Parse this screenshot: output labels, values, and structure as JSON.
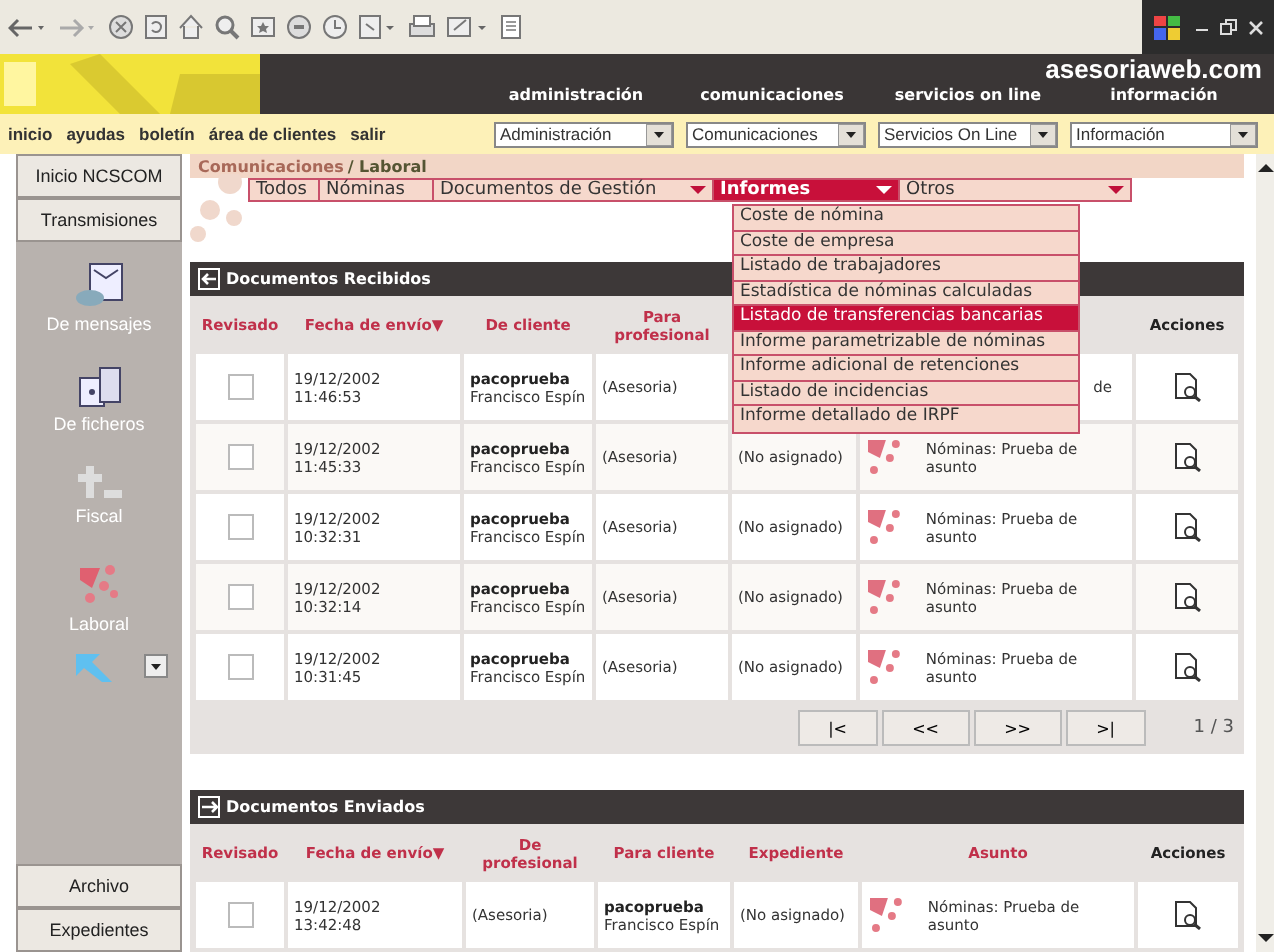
{
  "header": {
    "site": "asesoriaweb.com",
    "nav": [
      "administración",
      "comunicaciones",
      "servicios on line",
      "información"
    ]
  },
  "links": [
    "inicio",
    "ayudas",
    "boletín",
    "área de clientes",
    "salir"
  ],
  "selects": [
    "Administración",
    "Comunicaciones",
    "Servicios On Line",
    "Información"
  ],
  "sidebar": {
    "top_buttons": [
      "Inicio NCSCOM",
      "Transmisiones"
    ],
    "items": [
      {
        "label": "De mensajes",
        "kind": "messages"
      },
      {
        "label": "De ficheros",
        "kind": "files"
      },
      {
        "label": "Fiscal",
        "kind": "fiscal"
      },
      {
        "label": "Laboral",
        "kind": "laboral"
      }
    ],
    "bottom_buttons": [
      "Archivo",
      "Expedientes"
    ]
  },
  "breadcrumb": {
    "parent": "Comunicaciones",
    "current": "/ Laboral"
  },
  "tabs": [
    {
      "label": "Todos",
      "selected": false,
      "dropdown": false
    },
    {
      "label": "Nóminas",
      "selected": false,
      "dropdown": false
    },
    {
      "label": "Documentos de Gestión",
      "selected": false,
      "dropdown": true
    },
    {
      "label": "Informes",
      "selected": true,
      "dropdown": true
    },
    {
      "label": "Otros",
      "selected": false,
      "dropdown": true
    }
  ],
  "menu": [
    {
      "label": "Coste de nómina",
      "selected": false
    },
    {
      "label": "Coste de empresa",
      "selected": false
    },
    {
      "label": "Listado de trabajadores",
      "selected": false
    },
    {
      "label": "Estadística de nóminas calculadas",
      "selected": false
    },
    {
      "label": "Listado de transferencias bancarias",
      "selected": true
    },
    {
      "label": "Informe parametrizable de nóminas",
      "selected": false
    },
    {
      "label": "Informe adicional de retenciones",
      "selected": false
    },
    {
      "label": "Listado de incidencias",
      "selected": false
    },
    {
      "label": "Informe detallado de IRPF",
      "selected": false
    }
  ],
  "received": {
    "title": "Documentos Recibidos",
    "columns": [
      {
        "label": "Revisado"
      },
      {
        "label": "Fecha de envío",
        "sort_mark": "▼"
      },
      {
        "label": "De cliente"
      },
      {
        "label": "Para profesional"
      },
      {
        "label": "Acciones"
      }
    ],
    "rows": [
      {
        "checked": false,
        "date": "19/12/2002",
        "time": "11:46:53",
        "user": "pacoprueba",
        "name": "Francisco Espín",
        "profesional": "(Asesoria)",
        "asunto": "de",
        "asunto_icon": false
      },
      {
        "checked": false,
        "date": "19/12/2002",
        "time": "11:45:33",
        "user": "pacoprueba",
        "name": "Francisco Espín",
        "profesional": "(Asesoria)",
        "expediente": "(No asignado)",
        "asunto": "Nóminas: Prueba de asunto",
        "asunto_icon": true
      },
      {
        "checked": false,
        "date": "19/12/2002",
        "time": "10:32:31",
        "user": "pacoprueba",
        "name": "Francisco Espín",
        "profesional": "(Asesoria)",
        "expediente": "(No asignado)",
        "asunto": "Nóminas: Prueba de asunto",
        "asunto_icon": true
      },
      {
        "checked": false,
        "date": "19/12/2002",
        "time": "10:32:14",
        "user": "pacoprueba",
        "name": "Francisco Espín",
        "profesional": "(Asesoria)",
        "expediente": "(No asignado)",
        "asunto": "Nóminas: Prueba de asunto",
        "asunto_icon": true
      },
      {
        "checked": false,
        "date": "19/12/2002",
        "time": "10:31:45",
        "user": "pacoprueba",
        "name": "Francisco Espín",
        "profesional": "(Asesoria)",
        "expediente": "(No asignado)",
        "asunto": "Nóminas: Prueba de asunto",
        "asunto_icon": true
      }
    ],
    "pager": [
      "|<",
      "<<",
      ">>",
      ">|"
    ],
    "page": "1 / 3"
  },
  "sent": {
    "title": "Documentos Enviados",
    "columns": [
      {
        "label": "Revisado"
      },
      {
        "label": "Fecha de envío",
        "sort_mark": "▼"
      },
      {
        "label": "De profesional"
      },
      {
        "label": "Para cliente"
      },
      {
        "label": "Expediente"
      },
      {
        "label": "Asunto"
      },
      {
        "label": "Acciones"
      }
    ],
    "rows": [
      {
        "checked": false,
        "date": "19/12/2002",
        "time": "13:42:48",
        "profesional": "(Asesoria)",
        "user": "pacoprueba",
        "name": "Francisco Espín",
        "expediente": "(No asignado)",
        "asunto": "Nóminas: Prueba de asunto",
        "asunto_icon": true
      }
    ]
  }
}
